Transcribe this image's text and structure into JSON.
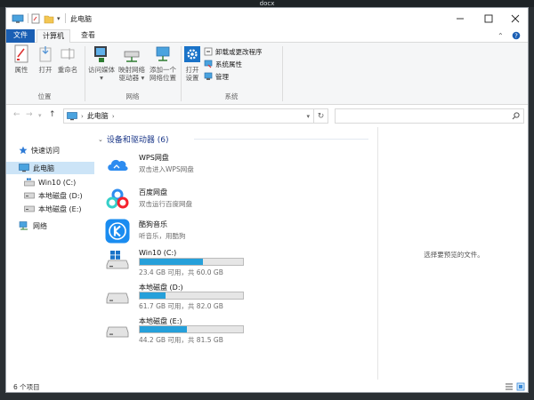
{
  "desktop": {
    "title": "docx"
  },
  "window": {
    "title": "此电脑",
    "tabs": {
      "file": "文件",
      "computer": "计算机",
      "view": "查看"
    },
    "ribbon": {
      "location": {
        "group_label": "位置",
        "buttons": [
          {
            "label": "属性"
          },
          {
            "label": "打开"
          },
          {
            "label": "重命名"
          }
        ]
      },
      "network": {
        "group_label": "网络",
        "buttons": [
          {
            "line1": "访问媒体",
            "line2": "▾"
          },
          {
            "line1": "映射网络",
            "line2": "驱动器 ▾"
          },
          {
            "line1": "添加一个",
            "line2": "网络位置"
          }
        ]
      },
      "system": {
        "group_label": "系统",
        "open_settings": {
          "line1": "打开",
          "line2": "设置"
        },
        "items": [
          "卸载或更改程序",
          "系统属性",
          "管理"
        ]
      }
    },
    "address": {
      "location": "此电脑"
    },
    "nav": {
      "quick_access": "快速访问",
      "this_pc": "此电脑",
      "drives": [
        "Win10 (C:)",
        "本地磁盘 (D:)",
        "本地磁盘 (E:)"
      ],
      "network": "网络"
    },
    "content": {
      "group_header": "设备和驱动器 (6)",
      "apps": [
        {
          "name": "WPS网盘",
          "sub": "双击进入WPS网盘",
          "icon": "wps-cloud-icon"
        },
        {
          "name": "百度网盘",
          "sub": "双击运行百度网盘",
          "icon": "baidu-netdisk-icon"
        },
        {
          "name": "酷狗音乐",
          "sub": "听音乐，用酷狗",
          "icon": "kugou-music-icon"
        }
      ],
      "drives": [
        {
          "name": "Win10 (C:)",
          "sub": "23.4 GB 可用，共 60.0 GB",
          "used_fraction": 0.61
        },
        {
          "name": "本地磁盘 (D:)",
          "sub": "61.7 GB 可用，共 82.0 GB",
          "used_fraction": 0.25
        },
        {
          "name": "本地磁盘 (E:)",
          "sub": "44.2 GB 可用，共 81.5 GB",
          "used_fraction": 0.46
        }
      ]
    },
    "preview": {
      "text": "选择要预览的文件。"
    },
    "status": {
      "count": "6 个项目"
    }
  },
  "colors": {
    "accent": "#1a5fb4",
    "selection": "#cce4f7",
    "drive_bar": "#26a0da"
  }
}
